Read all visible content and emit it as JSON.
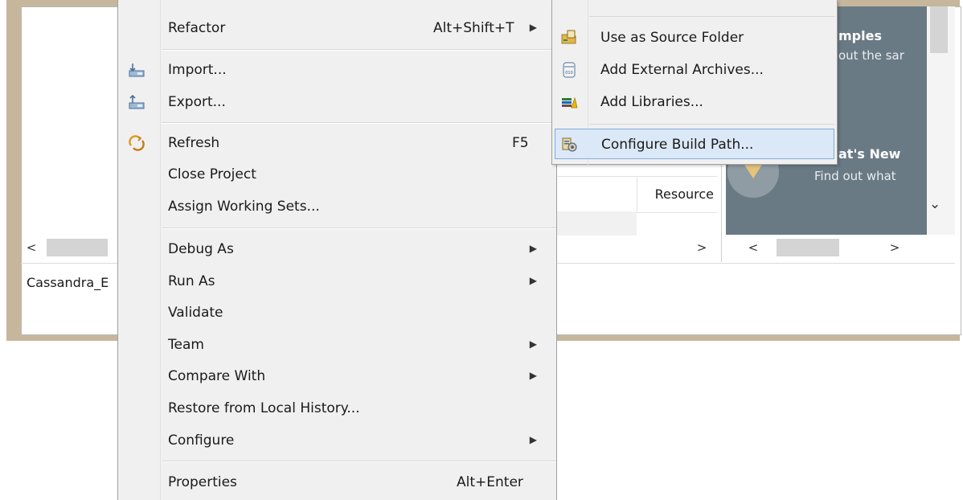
{
  "background": {
    "status_text": "Cassandra_E",
    "table_header": "Resource",
    "scroll_left": "<",
    "scroll_right": ">",
    "scroll_down": "⌄",
    "welcome": {
      "samples_title": "mples",
      "samples_desc": "out the sar",
      "whats_new_title": "at's New",
      "whats_new_desc": "Find out what"
    }
  },
  "menu": {
    "items": [
      {
        "label": "Refactor",
        "accel": "Alt+Shift+T",
        "submenu": true,
        "icon": ""
      },
      {
        "label": "Import...",
        "accel": "",
        "submenu": false,
        "icon": "import-icon"
      },
      {
        "label": "Export...",
        "accel": "",
        "submenu": false,
        "icon": "export-icon"
      },
      {
        "label": "Refresh",
        "accel": "F5",
        "submenu": false,
        "icon": "refresh-icon"
      },
      {
        "label": "Close Project",
        "accel": "",
        "submenu": false,
        "icon": ""
      },
      {
        "label": "Assign Working Sets...",
        "accel": "",
        "submenu": false,
        "icon": ""
      },
      {
        "label": "Debug As",
        "accel": "",
        "submenu": true,
        "icon": ""
      },
      {
        "label": "Run As",
        "accel": "",
        "submenu": true,
        "icon": ""
      },
      {
        "label": "Validate",
        "accel": "",
        "submenu": false,
        "icon": ""
      },
      {
        "label": "Team",
        "accel": "",
        "submenu": true,
        "icon": ""
      },
      {
        "label": "Compare With",
        "accel": "",
        "submenu": true,
        "icon": ""
      },
      {
        "label": "Restore from Local History...",
        "accel": "",
        "submenu": false,
        "icon": ""
      },
      {
        "label": "Configure",
        "accel": "",
        "submenu": true,
        "icon": ""
      },
      {
        "label": "Properties",
        "accel": "Alt+Enter",
        "submenu": false,
        "icon": ""
      }
    ]
  },
  "submenu": {
    "items": [
      {
        "label": "Use as Source Folder",
        "icon": "source-folder-icon",
        "highlighted": false
      },
      {
        "label": "Add External Archives...",
        "icon": "jar-archive-icon",
        "highlighted": false
      },
      {
        "label": "Add Libraries...",
        "icon": "libraries-icon",
        "highlighted": false
      },
      {
        "label": "Configure Build Path...",
        "icon": "build-path-icon",
        "highlighted": true
      }
    ]
  },
  "colors": {
    "menu_bg": "#f0f0f0",
    "highlight_bg": "#dbe8f7",
    "highlight_border": "#84acdd",
    "welcome_bg": "#6a7a84",
    "window_frame": "#c6b69c"
  }
}
